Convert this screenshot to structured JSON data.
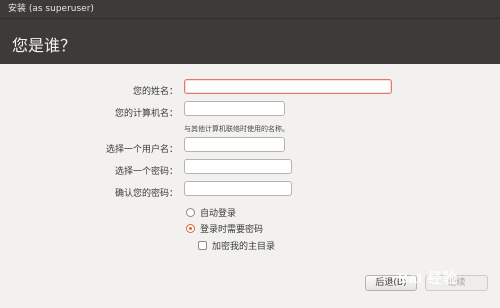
{
  "window": {
    "title": "安装 (as superuser)"
  },
  "page": {
    "heading": "您是谁？"
  },
  "form": {
    "name_label": "您的姓名：",
    "computer_label": "您的计算机名：",
    "computer_hint": "与其他计算机联络时使用的名称。",
    "username_label": "选择一个用户名：",
    "password_label": "选择一个密码：",
    "confirm_label": "确认您的密码：",
    "name_value": "",
    "computer_value": "",
    "username_value": "",
    "password_value": "",
    "confirm_value": ""
  },
  "options": {
    "auto_login": "自动登录",
    "require_password": "登录时需要密码",
    "encrypt_home": "加密我的主目录"
  },
  "buttons": {
    "back": "后退(B)",
    "forward": "继续"
  },
  "watermark": "Bai 经验"
}
